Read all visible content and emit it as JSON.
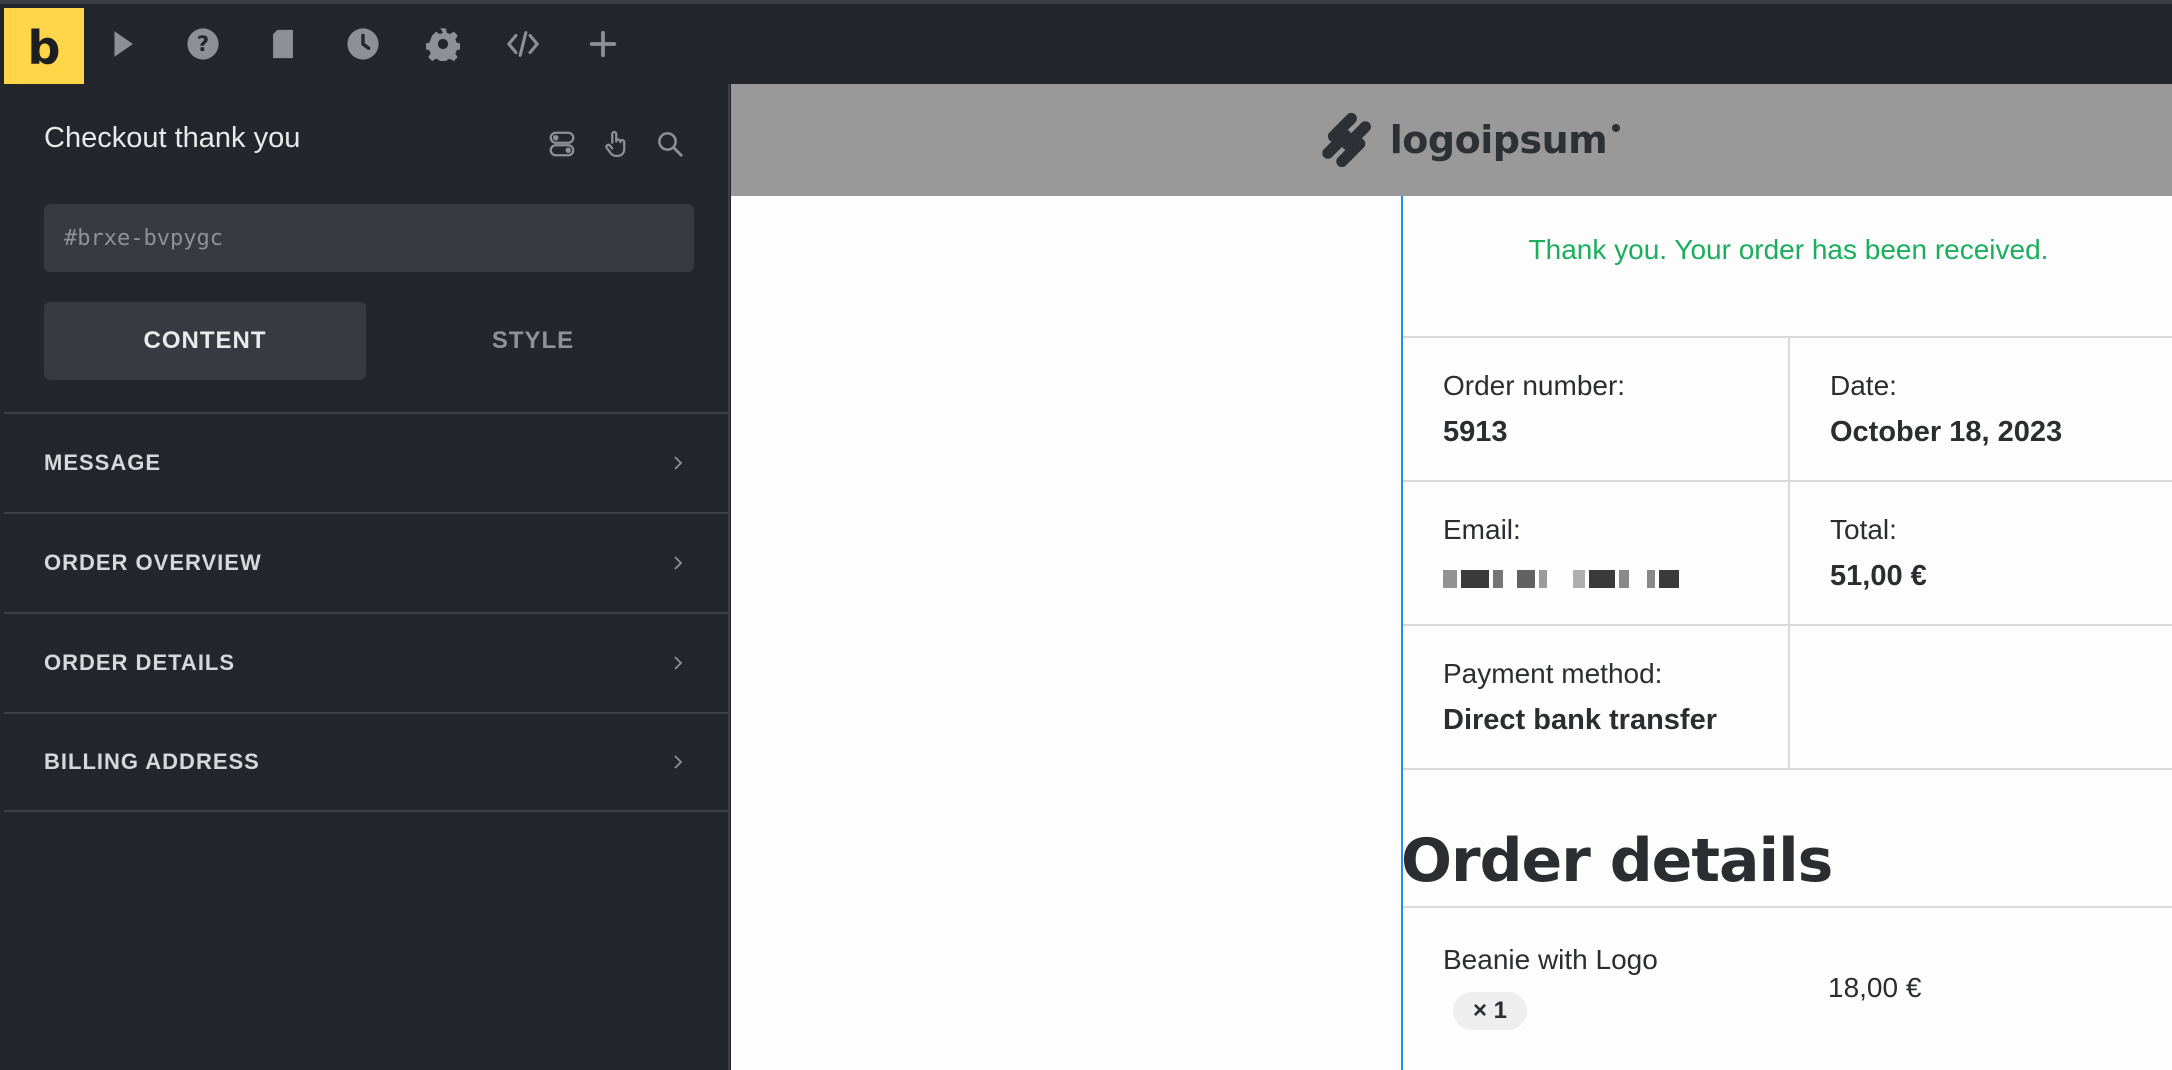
{
  "toolbar": {
    "brand_letter": "b",
    "icons": [
      "select-icon",
      "help-icon",
      "page-icon",
      "history-icon",
      "settings-icon",
      "code-icon",
      "add-icon"
    ]
  },
  "panel": {
    "title": "Checkout thank you",
    "id_placeholder": "#brxe-bvpygc",
    "tabs": {
      "content": "CONTENT",
      "style": "STYLE"
    },
    "sections": [
      "MESSAGE",
      "ORDER OVERVIEW",
      "ORDER DETAILS",
      "BILLING ADDRESS"
    ]
  },
  "canvas": {
    "brand_name": "logoipsum",
    "thank_you": "Thank you. Your order has been received.",
    "overview": {
      "order_number_label": "Order number:",
      "order_number": "5913",
      "date_label": "Date:",
      "date": "October 18, 2023",
      "email_label": "Email:",
      "total_label": "Total:",
      "total": "51,00 €",
      "payment_label": "Payment method:",
      "payment": "Direct bank transfer"
    },
    "order_details_title": "Order details",
    "items": [
      {
        "name": "Beanie with Logo",
        "qty": "× 1",
        "price": "18,00 €"
      }
    ]
  },
  "colors": {
    "accent": "#ffd54a",
    "success_text": "#1aae5d",
    "selection_outline": "#2d8cf0",
    "panel_bg": "#23262b",
    "header_bg": "#999999"
  }
}
